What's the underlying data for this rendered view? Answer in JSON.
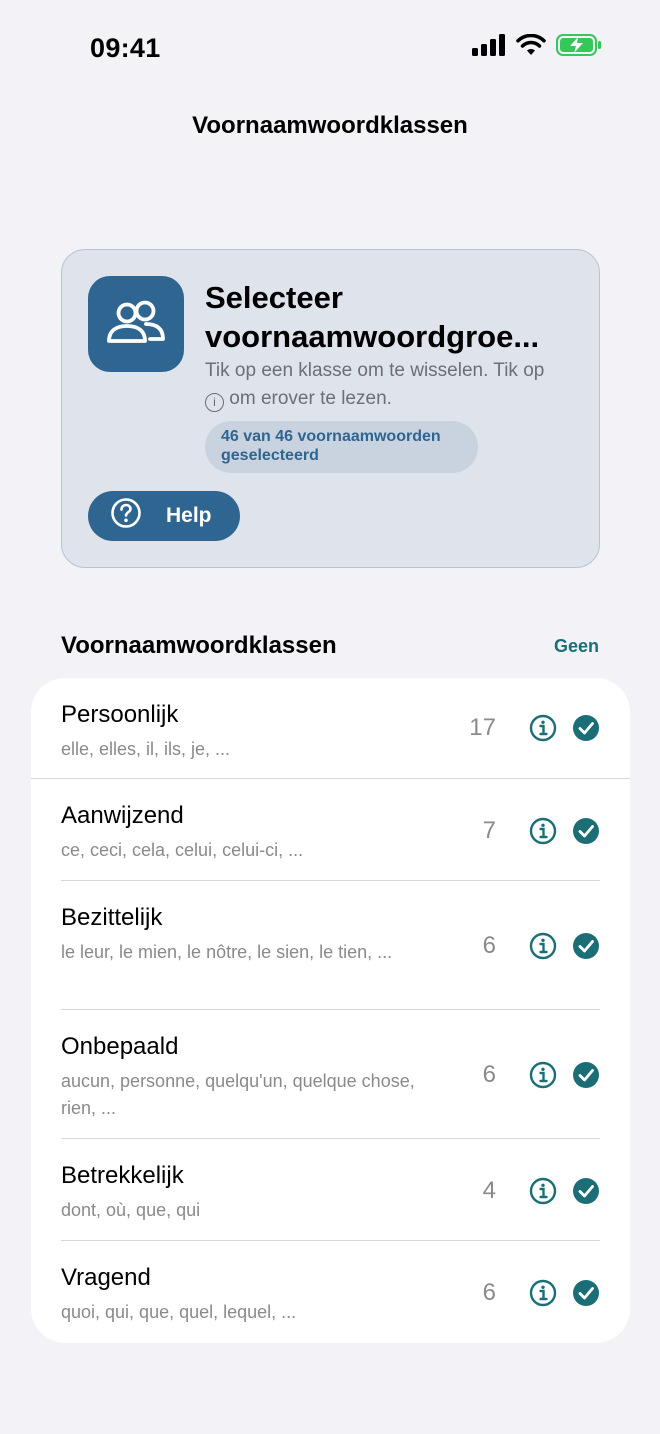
{
  "status_bar": {
    "time": "09:41"
  },
  "nav": {
    "title": "Voornaamwoordklassen"
  },
  "header": {
    "title": "Selecteer\nvoornaamwoordgroe...",
    "description_before": "Tik op een klasse om te wisselen. Tik op ",
    "info_glyph": "i",
    "description_after": " om erover te lezen.",
    "count_label": "46 van 46 voornaamwoorden geselecteerd",
    "help_label": "Help"
  },
  "section": {
    "title": "Voornaamwoordklassen",
    "action_label": "Geen"
  },
  "classes": [
    {
      "name": "Persoonlijk",
      "examples": "elle, elles, il, ils, je, ...",
      "count": "17",
      "selected": true
    },
    {
      "name": "Aanwijzend",
      "examples": "ce, ceci, cela, celui, celui-ci, ...",
      "count": "7",
      "selected": true
    },
    {
      "name": "Bezittelijk",
      "examples": "le leur, le mien, le nôtre, le sien, le tien, ...",
      "count": "6",
      "selected": true
    },
    {
      "name": "Onbepaald",
      "examples": "aucun, personne, quelqu'un, quelque chose, rien, ...",
      "count": "6",
      "selected": true
    },
    {
      "name": "Betrekkelijk",
      "examples": "dont, où, que, qui",
      "count": "4",
      "selected": true
    },
    {
      "name": "Vragend",
      "examples": "quoi, qui, que, quel, lequel, ...",
      "count": "6",
      "selected": true
    }
  ],
  "colors": {
    "accent": "#1b6e76",
    "brand": "#2f6591",
    "background": "#f2f2f7",
    "battery": "#34c759"
  },
  "icons": {
    "app": "people-icon",
    "help": "question-circle-icon",
    "info": "info-circle-icon",
    "check": "checkmark-circle-icon"
  }
}
